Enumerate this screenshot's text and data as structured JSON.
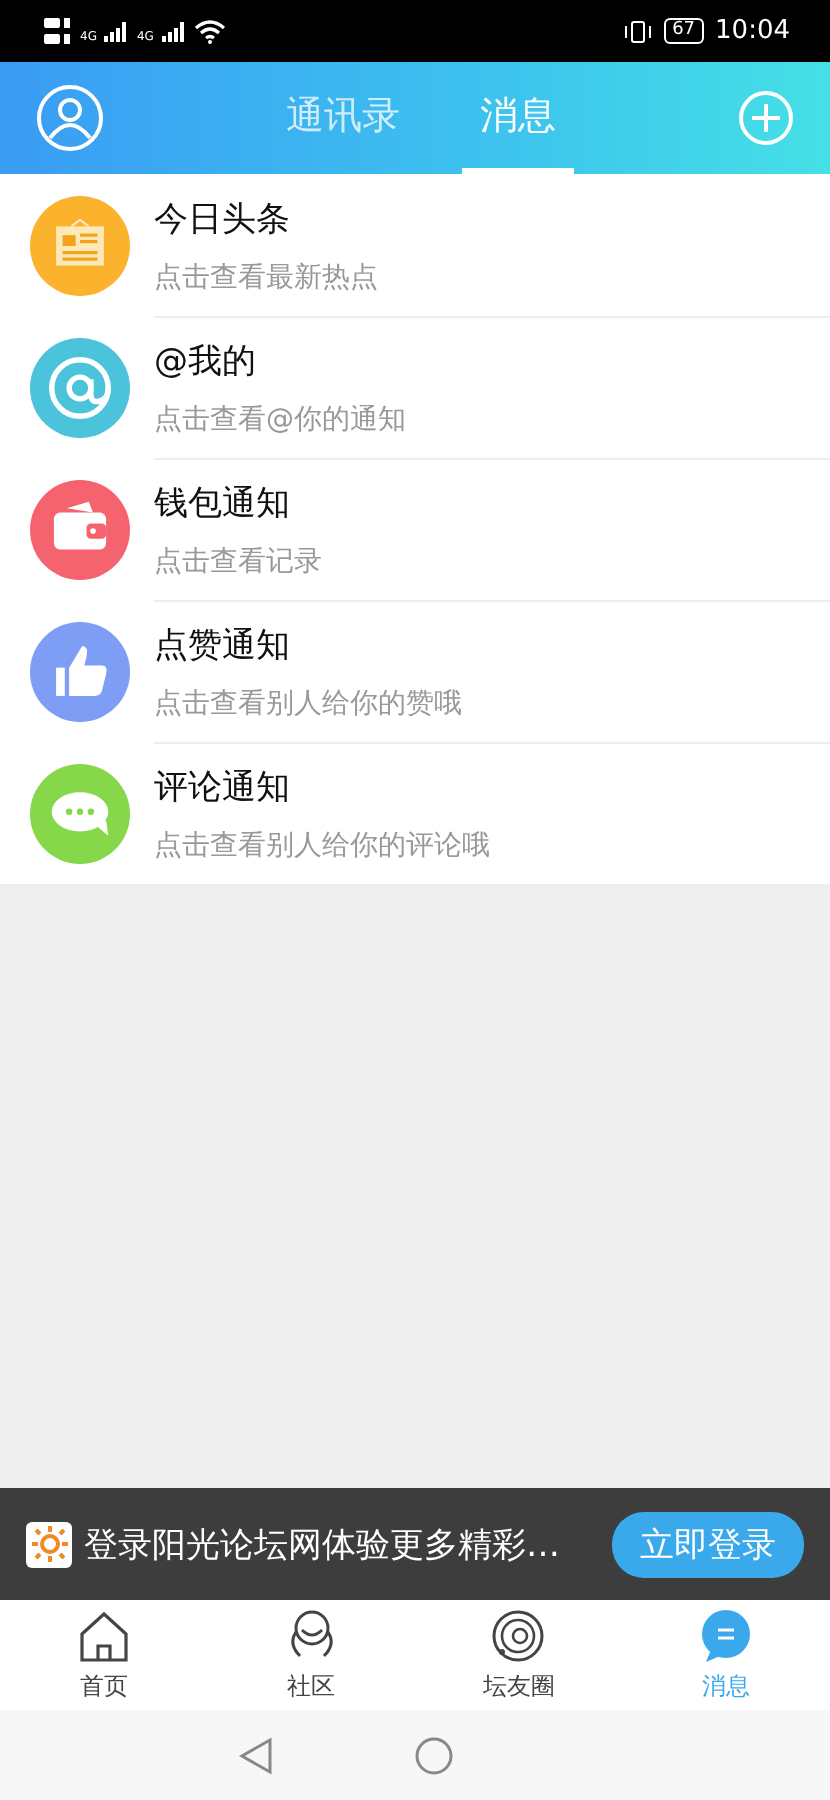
{
  "status_bar": {
    "network_1": "4G",
    "network_2": "4G",
    "battery": "67",
    "time": "10:04"
  },
  "header": {
    "tabs": [
      {
        "label": "通讯录",
        "selected": false
      },
      {
        "label": "消息",
        "selected": true
      }
    ]
  },
  "messages": [
    {
      "kind": "news",
      "color": "#fbb22c",
      "title": "今日头条",
      "subtitle": "点击查看最新热点"
    },
    {
      "kind": "at",
      "color": "#4bc3da",
      "title": "@我的",
      "subtitle": "点击查看@你的通知"
    },
    {
      "kind": "wallet",
      "color": "#f5636e",
      "title": "钱包通知",
      "subtitle": "点击查看记录"
    },
    {
      "kind": "like",
      "color": "#7e9ef5",
      "title": "点赞通知",
      "subtitle": "点击查看别人给你的赞哦"
    },
    {
      "kind": "comment",
      "color": "#86d84a",
      "title": "评论通知",
      "subtitle": "点击查看别人给你的评论哦"
    }
  ],
  "login_banner": {
    "text": "登录阳光论坛网体验更多精彩…",
    "button": "立即登录"
  },
  "bottom_tabs": [
    {
      "kind": "home",
      "label": "首页",
      "selected": false
    },
    {
      "kind": "community",
      "label": "社区",
      "selected": false
    },
    {
      "kind": "circle",
      "label": "坛友圈",
      "selected": false
    },
    {
      "kind": "message",
      "label": "消息",
      "selected": true
    }
  ]
}
